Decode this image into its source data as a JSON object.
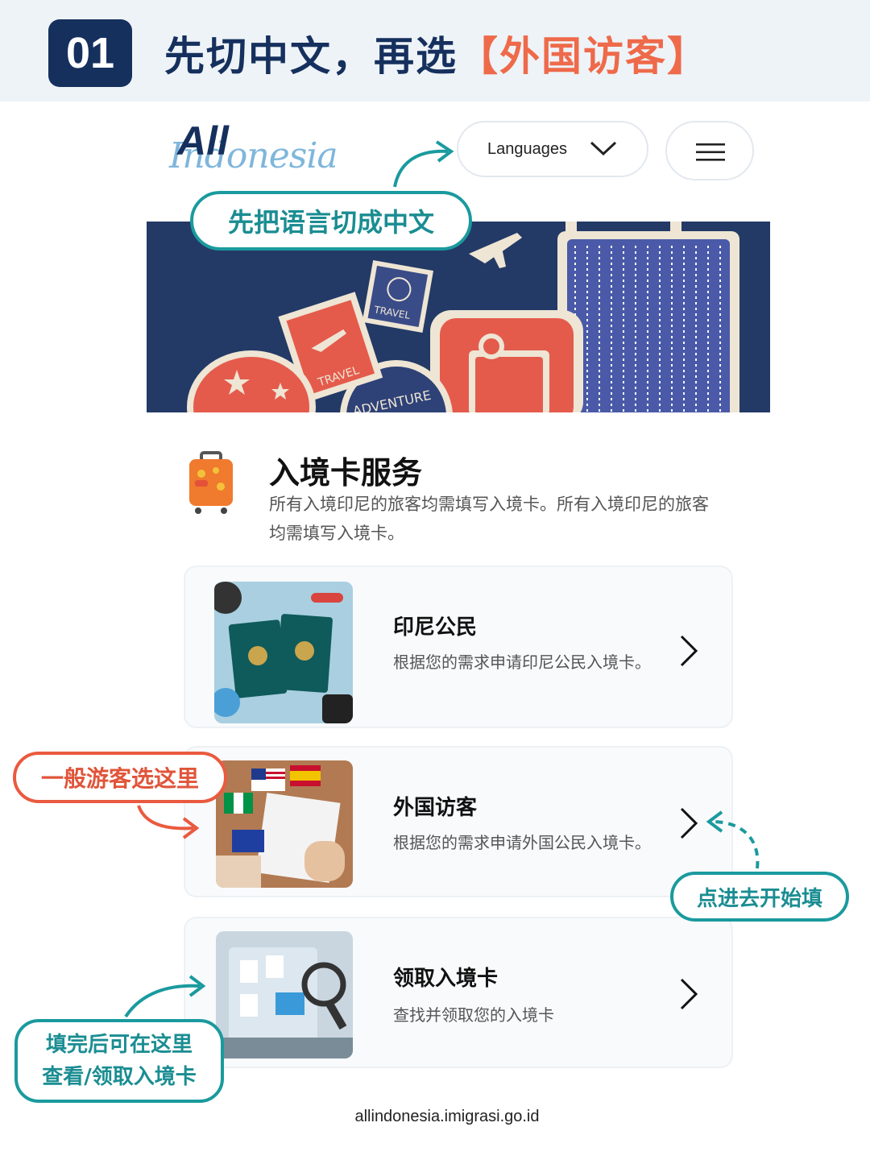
{
  "step": {
    "number": "01",
    "title_part1": "先切中文，再选",
    "title_highlight": "【外国访客】"
  },
  "header": {
    "logo_all": "All",
    "logo_script": "Indonesia",
    "languages_label": "Languages"
  },
  "hero": {
    "stamp_travel": "TRAVEL",
    "stamp_travel2": "TRAVEL",
    "stamp_adventure": "ADVENTURE"
  },
  "annotations": {
    "switch_language": "先把语言切成中文",
    "general_visitors": "一般游客选这里",
    "click_to_start": "点进去开始填",
    "after_filling_line1": "填完后可在这里",
    "after_filling_line2": "查看/领取入境卡"
  },
  "service": {
    "title": "入境卡服务",
    "description": "所有入境印尼的旅客均需填写入境卡。所有入境印尼的旅客均需填写入境卡。"
  },
  "cards": [
    {
      "title": "印尼公民",
      "description": "根据您的需求申请印尼公民入境卡。"
    },
    {
      "title": "外国访客",
      "description": "根据您的需求申请外国公民入境卡。"
    },
    {
      "title": "领取入境卡",
      "description": "查找并领取您的入境卡"
    }
  ],
  "url": "allindonesia.imigrasi.go.id",
  "colors": {
    "navy": "#16305e",
    "teal": "#1a9a9e",
    "orange": "#ea5a3f",
    "hero_bg": "#233a66",
    "stamp_red": "#e45b4c"
  }
}
